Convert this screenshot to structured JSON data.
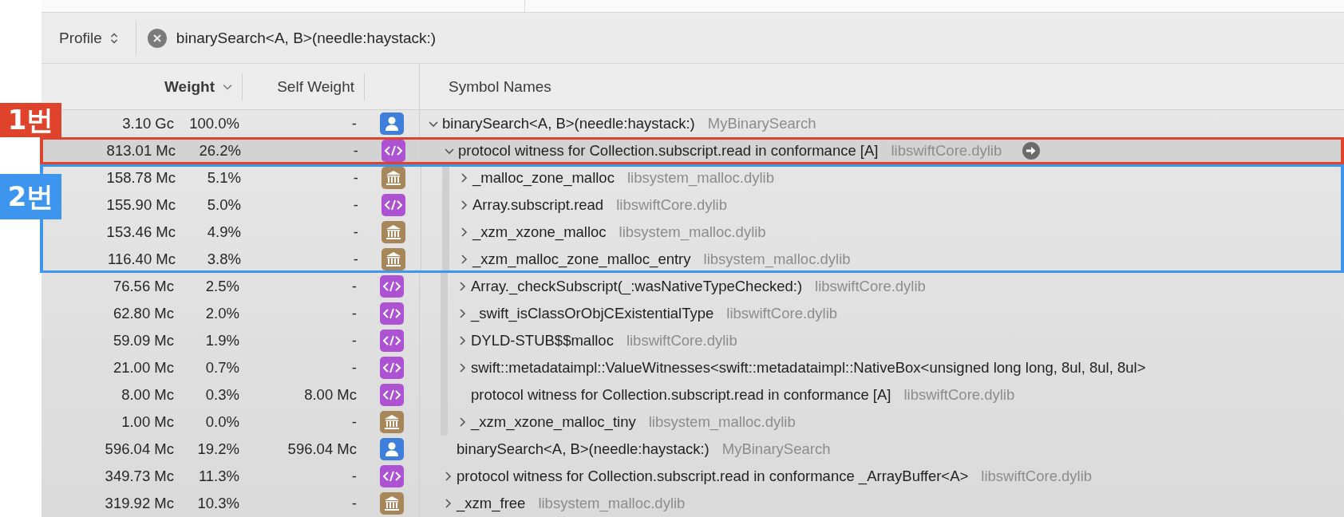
{
  "toolbar": {
    "scope": "Profile",
    "search": {
      "value": "binarySearch<A, B>(needle:haystack:)"
    }
  },
  "columns": [
    {
      "label": "Weight",
      "sorted": true
    },
    {
      "label": "Self Weight",
      "sorted": false
    },
    {
      "label": "Symbol Names",
      "sorted": false
    }
  ],
  "annotations": [
    {
      "label": "1번",
      "color": "#e0432c"
    },
    {
      "label": "2번",
      "color": "#3d95ee"
    }
  ],
  "tree": [
    {
      "weight": "3.10 Gc",
      "percent": "100.0%",
      "self_weight": "-",
      "kind": "user",
      "symbol": "binarySearch<A, B>(needle:haystack:)",
      "library": "MyBinarySearch",
      "expandable": true,
      "expanded": true,
      "selected": false,
      "children": [
        {
          "weight": "813.01 Mc",
          "percent": "26.2%",
          "self_weight": "-",
          "kind": "code",
          "symbol": "protocol witness for Collection.subscript.read in conformance [A]",
          "library": "libswiftCore.dylib",
          "expandable": true,
          "expanded": true,
          "selected": true,
          "color": "#e0432c",
          "children": [
            {
              "weight": "158.78 Mc",
              "percent": "5.1%",
              "self_weight": "-",
              "kind": "library",
              "symbol": "_malloc_zone_malloc",
              "library": "libsystem_malloc.dylib",
              "expandable": true,
              "expanded": false,
              "selected": false,
              "color": "#3d95ee"
            },
            {
              "weight": "155.90 Mc",
              "percent": "5.0%",
              "self_weight": "-",
              "kind": "code",
              "symbol": "Array.subscript.read",
              "library": "libswiftCore.dylib",
              "expandable": true,
              "expanded": false,
              "selected": false,
              "color": "#3d95ee"
            },
            {
              "weight": "153.46 Mc",
              "percent": "4.9%",
              "self_weight": "-",
              "kind": "library",
              "symbol": "_xzm_xzone_malloc",
              "library": "libsystem_malloc.dylib",
              "expandable": true,
              "expanded": false,
              "selected": false,
              "color": "#3d95ee"
            },
            {
              "weight": "116.40 Mc",
              "percent": "3.8%",
              "self_weight": "-",
              "kind": "library",
              "symbol": "_xzm_malloc_zone_malloc_entry",
              "library": "libsystem_malloc.dylib",
              "expandable": true,
              "expanded": false,
              "selected": false,
              "color": "#3d95ee"
            },
            {
              "weight": "76.56 Mc",
              "percent": "2.5%",
              "self_weight": "-",
              "kind": "code",
              "symbol": "Array._checkSubscript(_:wasNativeTypeChecked:)",
              "library": "libswiftCore.dylib",
              "expandable": true,
              "expanded": false,
              "selected": false
            },
            {
              "weight": "62.80 Mc",
              "percent": "2.0%",
              "self_weight": "-",
              "kind": "code",
              "symbol": "_swift_isClassOrObjCExistentialType",
              "library": "libswiftCore.dylib",
              "expandable": true,
              "expanded": false,
              "selected": false
            },
            {
              "weight": "59.09 Mc",
              "percent": "1.9%",
              "self_weight": "-",
              "kind": "code",
              "symbol": "DYLD-STUB$$malloc",
              "library": "libswiftCore.dylib",
              "expandable": true,
              "expanded": false,
              "selected": false
            },
            {
              "weight": "21.00 Mc",
              "percent": "0.7%",
              "self_weight": "-",
              "kind": "code",
              "symbol": "swift::metadataimpl::ValueWitnesses<swift::metadataimpl::NativeBox<unsigned long long, 8ul, 8ul, 8ul>",
              "expandable": true,
              "expanded": false,
              "selected": false
            },
            {
              "weight": "8.00 Mc",
              "percent": "0.3%",
              "self_weight": "8.00 Mc",
              "kind": "code",
              "symbol": "protocol witness for Collection.subscript.read in conformance [A]",
              "library": "libswiftCore.dylib",
              "expandable": false,
              "selected": false
            },
            {
              "weight": "1.00 Mc",
              "percent": "0.0%",
              "self_weight": "-",
              "kind": "library",
              "symbol": "_xzm_xzone_malloc_tiny",
              "library": "libsystem_malloc.dylib",
              "expandable": true,
              "expanded": false,
              "selected": false
            }
          ]
        },
        {
          "weight": "596.04 Mc",
          "percent": "19.2%",
          "self_weight": "596.04 Mc",
          "kind": "user",
          "symbol": "binarySearch<A, B>(needle:haystack:)",
          "library": "MyBinarySearch",
          "expandable": false,
          "selected": false
        },
        {
          "weight": "349.73 Mc",
          "percent": "11.3%",
          "self_weight": "-",
          "kind": "code",
          "symbol": "protocol witness for Collection.subscript.read in conformance _ArrayBuffer<A>",
          "library": "libswiftCore.dylib",
          "expandable": true,
          "expanded": false,
          "selected": false
        },
        {
          "weight": "319.92 Mc",
          "percent": "10.3%",
          "self_weight": "-",
          "kind": "library",
          "symbol": "_xzm_free",
          "library": "libsystem_malloc.dylib",
          "expandable": true,
          "expanded": false,
          "selected": false
        }
      ]
    }
  ]
}
